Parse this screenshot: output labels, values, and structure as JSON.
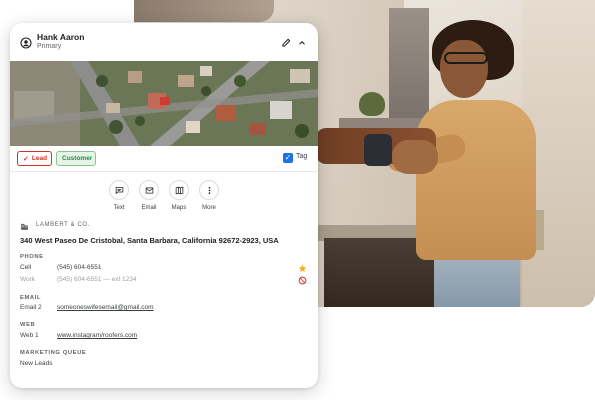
{
  "contact": {
    "name": "Hank Aaron",
    "subtitle": "Primary",
    "icons": {
      "person": "person-circle-icon",
      "edit": "pencil-icon",
      "collapse": "chevron-up-icon"
    }
  },
  "tags": {
    "lead": "Lead",
    "customer": "Customer",
    "tag_checkbox_label": "Tag",
    "colors": {
      "lead": "#d93025",
      "customer": "#1e8e3e",
      "checkbox": "#1a73e8"
    }
  },
  "actions": [
    {
      "label": "Text",
      "icon": "message-icon"
    },
    {
      "label": "Email",
      "icon": "mail-icon"
    },
    {
      "label": "Maps",
      "icon": "map-icon"
    },
    {
      "label": "More",
      "icon": "more-vertical-icon"
    }
  ],
  "company": {
    "name": "LAMBERT & CO.",
    "icon": "building-icon"
  },
  "address": "340 West Paseo De Cristobal, Santa Barbara, California 92672-2923, USA",
  "phone": {
    "title": "PHONE",
    "rows": [
      {
        "label": "Cell",
        "value": "(545) 604-6551"
      },
      {
        "label": "Work",
        "value": "(545) 604-6551  —  ext 1234"
      }
    ]
  },
  "email": {
    "title": "EMAIL",
    "label": "Email 2",
    "value": "someoneswifesemail@gmail.com"
  },
  "web": {
    "title": "WEB",
    "label": "Web 1",
    "value": "www.instagram/roofers.com"
  },
  "marketing": {
    "title": "MARKETING QUEUE",
    "value": "New Leads"
  }
}
